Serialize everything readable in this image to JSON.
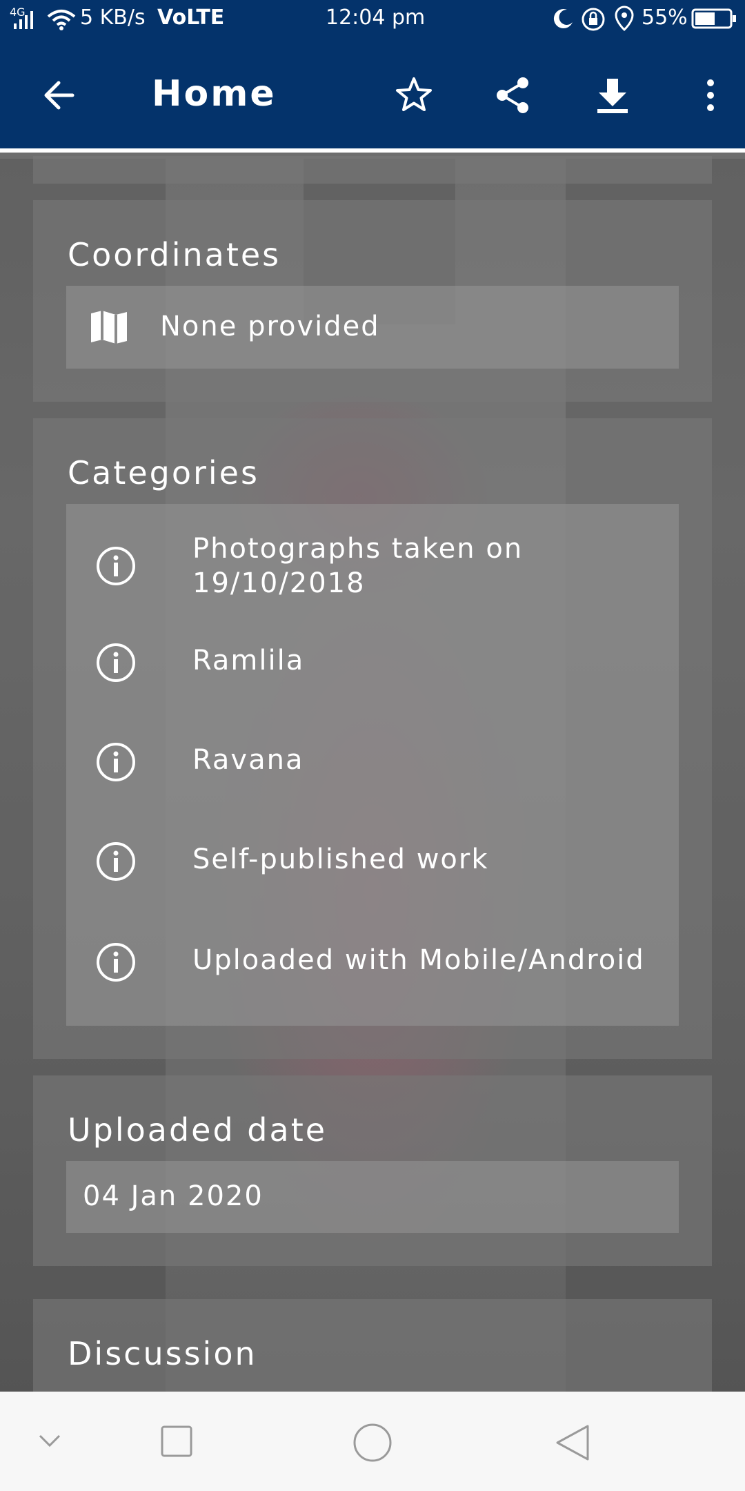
{
  "status_bar": {
    "network": "4G",
    "speed": "5 KB/s",
    "volte": "VoLTE",
    "time": "12:04 pm",
    "battery": "55%"
  },
  "app_bar": {
    "title": "Home",
    "actions": [
      "star-icon",
      "share-icon",
      "download-icon",
      "more-vert-icon"
    ]
  },
  "coordinates": {
    "title": "Coordinates",
    "value": "None provided",
    "icon": "map-icon"
  },
  "categories": {
    "title": "Categories",
    "items": [
      {
        "label_line1": "Photographs taken on",
        "label_line2": "19/10/2018"
      },
      {
        "label": "Ramlila"
      },
      {
        "label": "Ravana"
      },
      {
        "label": "Self-published work"
      },
      {
        "label": "Uploaded with Mobile/Android"
      }
    ]
  },
  "uploaded_date": {
    "title": "Uploaded date",
    "value": "04 Jan 2020"
  },
  "discussion": {
    "title": "Discussion"
  },
  "nav_bar": [
    "chevron-down-icon",
    "recent-apps-icon",
    "home-icon",
    "back-icon"
  ]
}
